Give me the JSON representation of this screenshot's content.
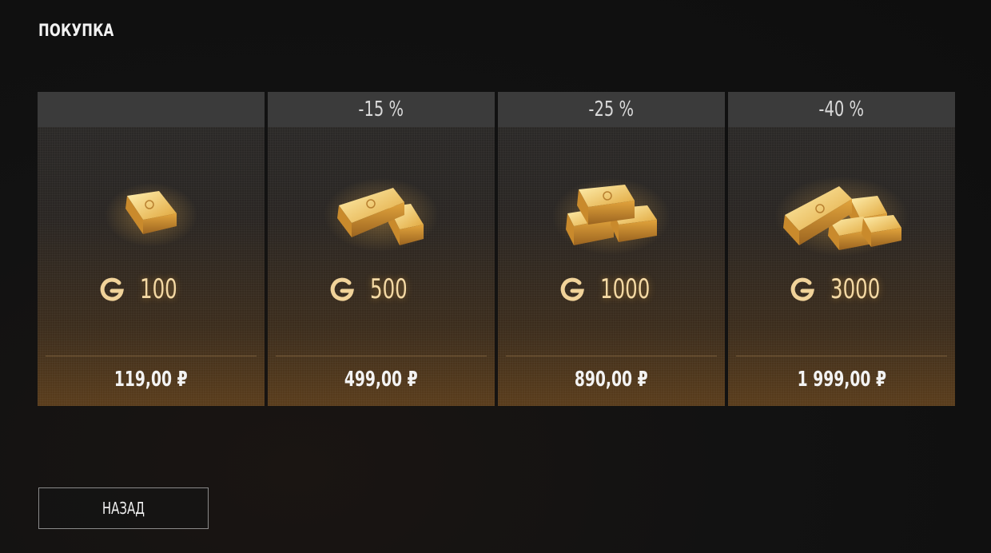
{
  "header": {
    "title": "ПОКУПКА"
  },
  "offers": [
    {
      "discount": "",
      "amount": "100",
      "price": "119,00 ₽",
      "bars": 1
    },
    {
      "discount": "-15 %",
      "amount": "500",
      "price": "499,00 ₽",
      "bars": 2
    },
    {
      "discount": "-25 %",
      "amount": "1000",
      "price": "890,00 ₽",
      "bars": 3
    },
    {
      "discount": "-40 %",
      "amount": "3000",
      "price": "1 999,00 ₽",
      "bars": 4
    }
  ],
  "currency_icon": "gold-coin-icon",
  "footer": {
    "back_label": "НАЗАД"
  },
  "colors": {
    "gold": "#f2c35a",
    "amount_text": "#f4d9a4",
    "header_bg": "#3b3b3b"
  }
}
